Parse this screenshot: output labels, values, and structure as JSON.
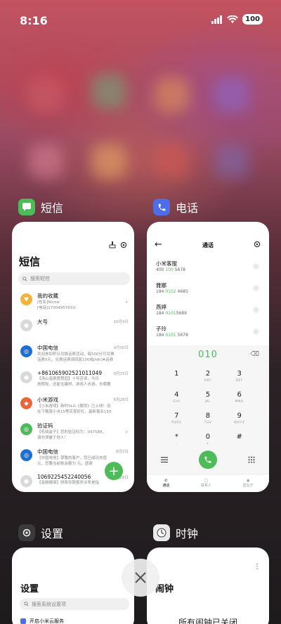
{
  "status": {
    "time": "8:16",
    "battery": "100"
  },
  "cards": {
    "sms": {
      "app_name": "短信",
      "title": "短信",
      "search_placeholder": "搜索短信",
      "messages": [
        {
          "name": "我的收藏",
          "date": "",
          "preview1": "[姓名]Nicow",
          "preview2": "[电话]17004957610;",
          "color": "#f2b33d",
          "glyph": "♥"
        },
        {
          "name": "大号",
          "date": "10月9日",
          "preview1": "",
          "preview2": "",
          "color": "#d9d9d9",
          "glyph": "◉"
        },
        {
          "name": "中国电信",
          "date": "9月30日",
          "preview1": "欢迎参加积分兑换话费活动，每500分可兑换",
          "preview2": "话费5元，兑换话费请回复106或jfdh]#话费",
          "color": "#1e6fd0",
          "glyph": "◎"
        },
        {
          "name": "+8610659025210110​49",
          "date": "9月25日",
          "preview1": "【汤山温泉度假园】十年苦读，今日",
          "preview2": "放假啦，还能住建材，游戏人去游，去哪要",
          "color": "#d9d9d9",
          "glyph": "◉"
        },
        {
          "name": "小米游戏",
          "date": "8月28日",
          "preview1": "【小米游戏】新时SLG《傲剑》已上线！设",
          "preview2": "在下载版小米15等实现好礼，最新事业150",
          "color": "#e8663a",
          "glyph": "◆"
        },
        {
          "name": "验证码",
          "date": "",
          "preview1": "【毛绒盒子】您的验证码为：047588，",
          "preview2": "请勿泄露于他人！",
          "color": "#4cbb58",
          "glyph": "◎"
        },
        {
          "name": "中国电信",
          "date": "8月2日",
          "preview1": "【中国电信】尊敬的客户，您已成功充值",
          "preview2": "元，您要当前账余额为 元，感谢",
          "color": "#1e6fd0",
          "glyph": "◎"
        },
        {
          "name": "106922545224​0056",
          "date": "7月28日",
          "preview1": "【金融健康】财政存款服务业务是指",
          "preview2": "",
          "color": "#d9d9d9",
          "glyph": "◉"
        }
      ]
    },
    "phone": {
      "app_name": "电话",
      "title": "通话",
      "contacts": [
        {
          "name": "小米客服",
          "num_pre": "400 ",
          "num_hl": "100",
          "num_post": " 5678"
        },
        {
          "name": "雅娜",
          "num_pre": "184 ",
          "num_hl": "0102",
          "num_post": " 4685"
        },
        {
          "name": "燕婷",
          "num_pre": "184 ",
          "num_hl": "0101",
          "num_post": "5689"
        },
        {
          "name": "子玲",
          "num_pre": "184 ",
          "num_hl": "0101",
          "num_post": " 5678"
        }
      ],
      "dialed": "010",
      "keys": [
        {
          "d": "1",
          "l": ""
        },
        {
          "d": "2",
          "l": "ABC"
        },
        {
          "d": "3",
          "l": "DEF"
        },
        {
          "d": "4",
          "l": "GHI"
        },
        {
          "d": "5",
          "l": "JKL"
        },
        {
          "d": "6",
          "l": "MNO"
        },
        {
          "d": "7",
          "l": "PQRS"
        },
        {
          "d": "8",
          "l": "TUV"
        },
        {
          "d": "9",
          "l": "WXYZ"
        },
        {
          "d": "*",
          "l": ","
        },
        {
          "d": "0",
          "l": "+"
        },
        {
          "d": "#",
          "l": ""
        }
      ],
      "tabs": [
        "通话",
        "联系人",
        "营业厅"
      ]
    },
    "settings": {
      "app_name": "设置",
      "title": "设置",
      "search_placeholder": "搜索系统设置项",
      "row": "开启小米云服务"
    },
    "clock": {
      "app_name": "时钟",
      "title": "闹钟",
      "empty_text": "所有闹钟已关闭"
    }
  },
  "colors": {
    "accent_green": "#4cbb58",
    "sms_icon": "#4cbb58",
    "phone_icon": "#4d6ee8",
    "settings_icon": "#3a3a3a",
    "clock_icon": "#e9e9e9"
  }
}
